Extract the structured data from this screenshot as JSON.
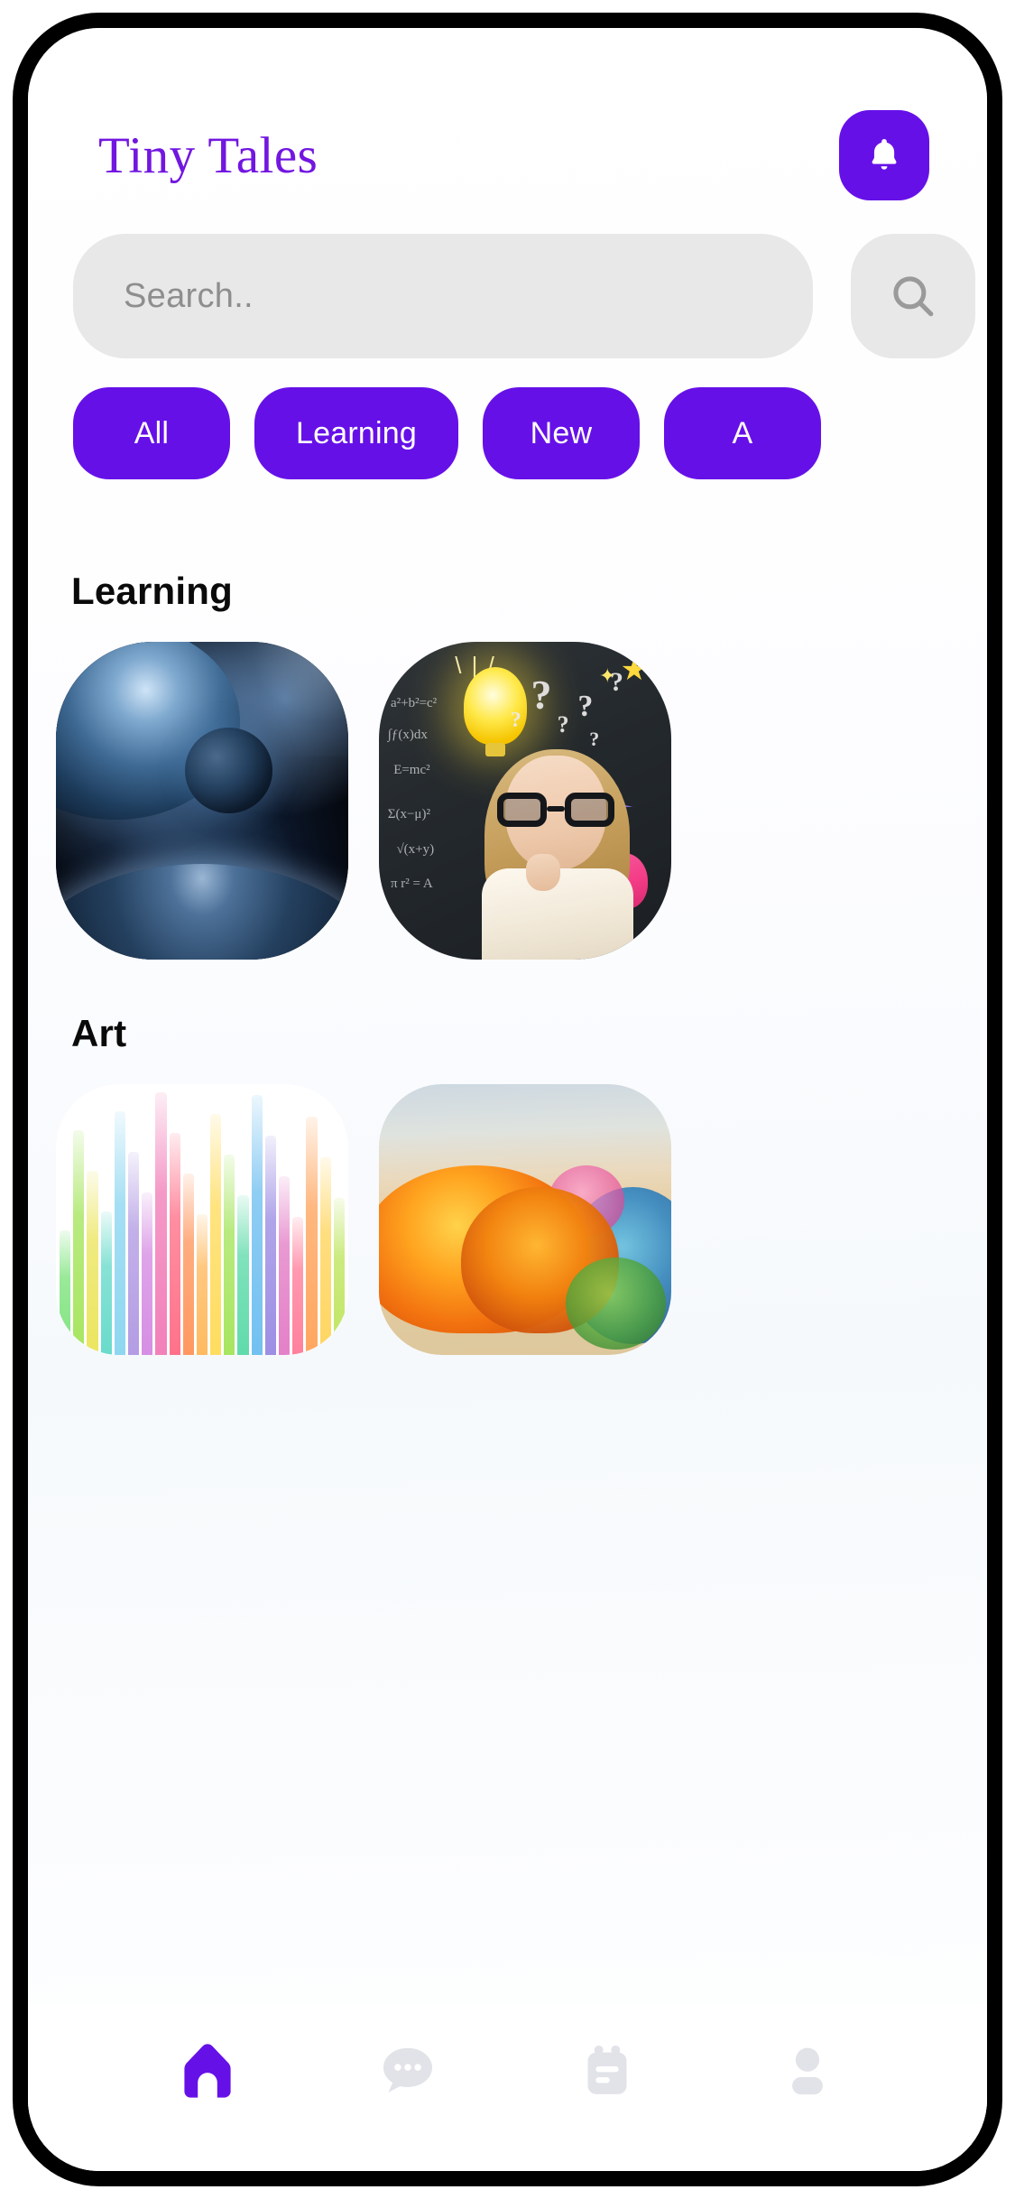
{
  "app": {
    "title": "Tiny Tales",
    "accent_color": "#6610e8",
    "title_color": "#7216e0"
  },
  "header": {
    "title": "Tiny Tales",
    "notification_icon": "bell-icon"
  },
  "search": {
    "placeholder": "Search..",
    "value": "",
    "button_icon": "search-icon"
  },
  "categories": [
    {
      "label": "All",
      "active": true
    },
    {
      "label": "Learning",
      "active": false
    },
    {
      "label": "New",
      "active": false
    },
    {
      "label": "A",
      "active": false
    }
  ],
  "sections": [
    {
      "title": "Learning",
      "cards": [
        {
          "name": "space-planets-card",
          "alt": "planets in space"
        },
        {
          "name": "chalkboard-girl-card",
          "alt": "girl with glasses thinking at chalkboard"
        }
      ]
    },
    {
      "title": "Art",
      "cards": [
        {
          "name": "paint-splash-skyline-card",
          "alt": "colorful paint splash skyline"
        },
        {
          "name": "autumn-tree-painting-card",
          "alt": "orange autumn tree painting"
        }
      ]
    }
  ],
  "bottom_nav": [
    {
      "name": "home",
      "icon": "home-icon",
      "active": true
    },
    {
      "name": "chat",
      "icon": "chat-bubble-icon",
      "active": false
    },
    {
      "name": "notes",
      "icon": "calendar-notes-icon",
      "active": false
    },
    {
      "name": "profile",
      "icon": "profile-icon",
      "active": false
    }
  ],
  "colors": {
    "purple": "#6610e8",
    "inactive_gray": "#e2e3e8",
    "field_gray": "#e8e8e8",
    "placeholder_gray": "#8e8e8e"
  },
  "splash_bars": [
    "#6fe06f",
    "#9be24a",
    "#e9e24a",
    "#55d6c4",
    "#7fd1ef",
    "#a98fe0",
    "#d07fe0",
    "#f06fb0",
    "#ff5f7a",
    "#ff8a4a",
    "#ffb14a",
    "#ffd84a",
    "#9be24a",
    "#4ad6a0",
    "#5fb8ef",
    "#8f7fe0",
    "#e06fc0",
    "#ff6f8f",
    "#ff9a4a",
    "#ffd04a",
    "#b6e24a"
  ]
}
